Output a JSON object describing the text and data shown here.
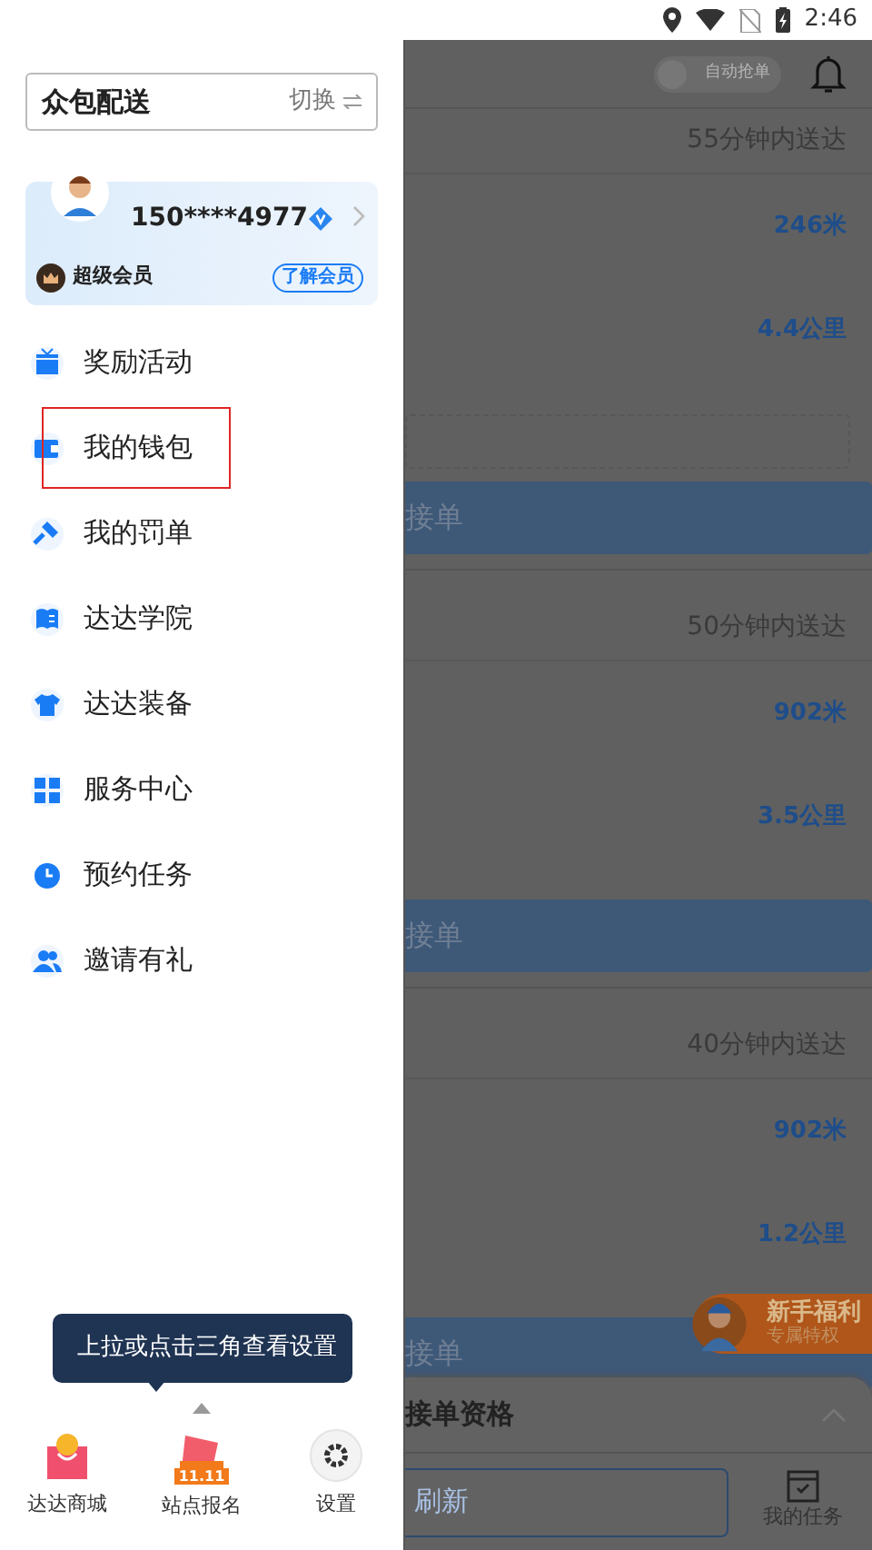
{
  "status_bar": {
    "time": "2:46"
  },
  "drawer": {
    "service": {
      "name": "众包配送",
      "switch_label": "切换"
    },
    "user": {
      "phone": "150****4977",
      "verified": true,
      "member_level": "超级会员",
      "member_link": "了解会员"
    },
    "menu": [
      {
        "label": "奖励活动",
        "kind": "gift",
        "highlighted": false
      },
      {
        "label": "我的钱包",
        "kind": "wallet",
        "highlighted": true
      },
      {
        "label": "我的罚单",
        "kind": "gavel",
        "highlighted": false
      },
      {
        "label": "达达学院",
        "kind": "book",
        "highlighted": false
      },
      {
        "label": "达达装备",
        "kind": "shirt",
        "highlighted": false
      },
      {
        "label": "服务中心",
        "kind": "grid",
        "highlighted": false
      },
      {
        "label": "预约任务",
        "kind": "clock",
        "highlighted": false
      },
      {
        "label": "邀请有礼",
        "kind": "people",
        "highlighted": false
      }
    ],
    "tooltip": "上拉或点击三角查看设置",
    "shortcuts": [
      {
        "label": "达达商城",
        "kind": "shop"
      },
      {
        "label": "站点报名",
        "kind": "event",
        "tag": "11.11"
      },
      {
        "label": "设置",
        "kind": "settings"
      }
    ]
  },
  "background": {
    "auto_grab": {
      "label": "自动抢单",
      "on": false
    },
    "orders": [
      {
        "eta": "55分钟内送达",
        "distances": [
          "246米",
          "4.4公里"
        ],
        "note_field": true,
        "button": "接单"
      },
      {
        "eta": "50分钟内送达",
        "distances": [
          "902米",
          "3.5公里"
        ],
        "note_field": false,
        "button": "接单"
      },
      {
        "eta": "40分钟内送达",
        "distances": [
          "902米",
          "1.2公里"
        ],
        "note_field": false,
        "button": "接单"
      }
    ],
    "promo": {
      "title": "新手福利",
      "subtitle": "专属特权"
    },
    "sheet": {
      "title": "接单资格",
      "expanded": false
    },
    "bottom_bar": {
      "refresh": "刷新",
      "tab": "我的任务"
    }
  }
}
